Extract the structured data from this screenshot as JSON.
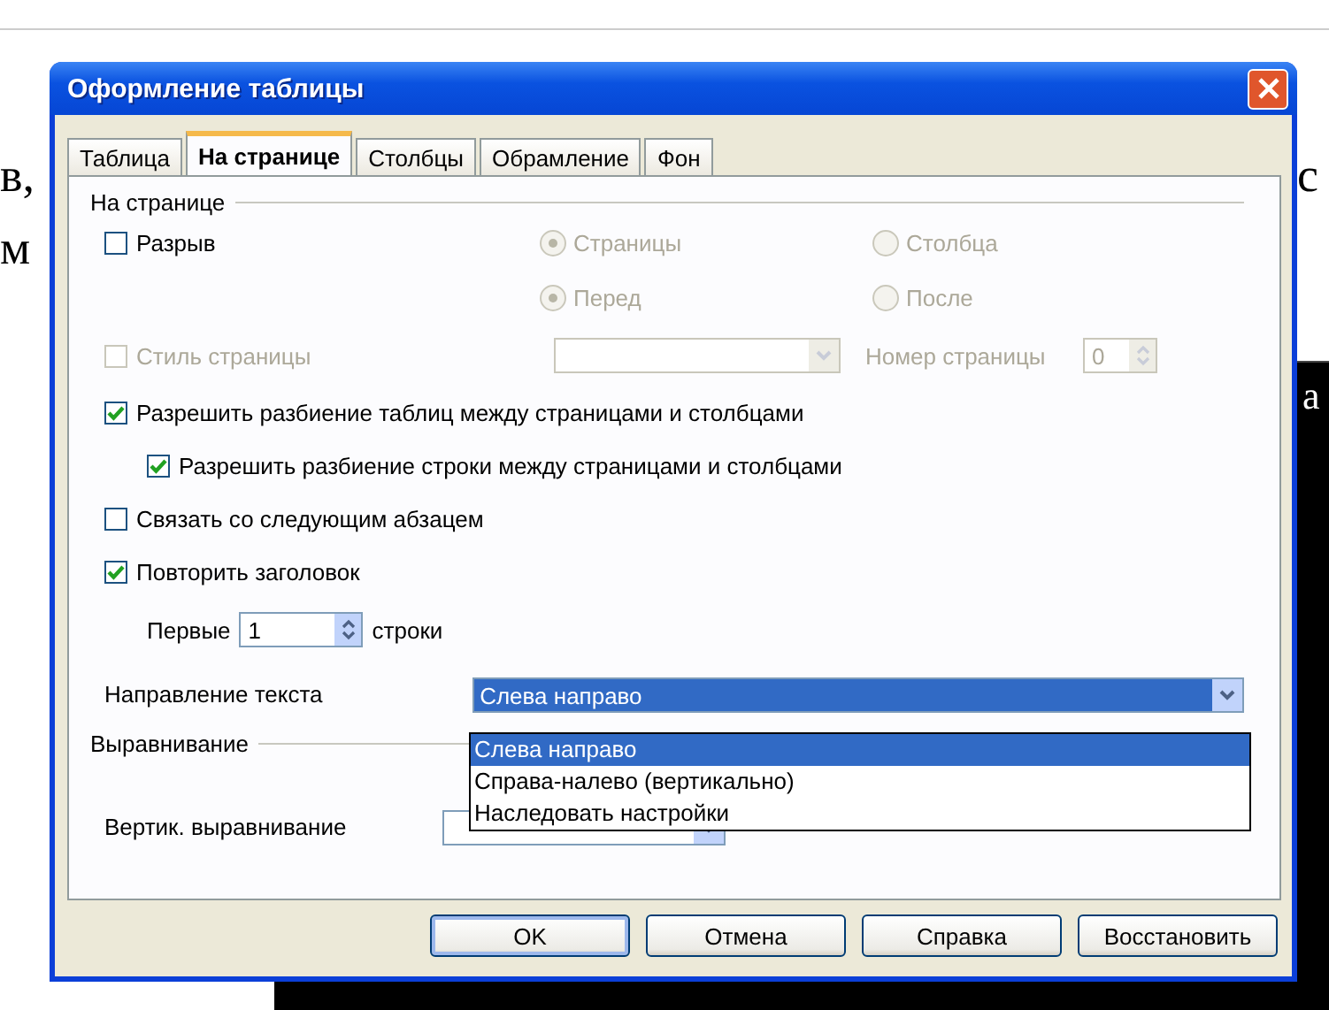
{
  "document": {
    "fragments": [
      {
        "text": "в,",
        "kind": "plain"
      },
      {
        "text": "с",
        "kind": "plain"
      },
      {
        "text": "м",
        "kind": "plain"
      },
      {
        "text": "a",
        "kind": "inverse"
      }
    ]
  },
  "dialog": {
    "title": "Оформление таблицы",
    "tabs": [
      {
        "label": "Таблица",
        "selected": false
      },
      {
        "label": "На странице",
        "selected": true
      },
      {
        "label": "Столбцы",
        "selected": false
      },
      {
        "label": "Обрамление",
        "selected": false
      },
      {
        "label": "Фон",
        "selected": false
      }
    ],
    "section_page": "На странице",
    "break": {
      "label": "Разрыв",
      "checked": false
    },
    "radios": [
      {
        "label": "Страницы",
        "selected": true,
        "disabled": true
      },
      {
        "label": "Столбца",
        "selected": false,
        "disabled": true
      },
      {
        "label": "Перед",
        "selected": true,
        "disabled": true
      },
      {
        "label": "После",
        "selected": false,
        "disabled": true
      }
    ],
    "page_style": {
      "label": "Стиль страницы",
      "checked": false,
      "disabled": true
    },
    "page_number": {
      "label": "Номер страницы",
      "value": "0",
      "disabled": true
    },
    "split_table": {
      "label": "Разрешить разбиение таблиц между страницами и столбцами",
      "checked": true
    },
    "split_row": {
      "label": "Разрешить разбиение строки между страницами и столбцами",
      "checked": true
    },
    "keep_next": {
      "label": "Связать со следующим абзацем",
      "checked": false
    },
    "repeat_heading": {
      "label": "Повторить заголовок",
      "checked": true
    },
    "first_rows": {
      "label": "Первые",
      "value": "1",
      "suffix": "строки"
    },
    "text_direction": {
      "label": "Направление текста",
      "value": "Слева направо",
      "expanded": true,
      "options": [
        {
          "label": "Слева направо",
          "selected": true
        },
        {
          "label": "Справа-налево (вертикально)",
          "selected": false
        },
        {
          "label": "Наследовать настройки",
          "selected": false
        }
      ]
    },
    "section_align": "Выравнивание",
    "vert_align": {
      "label": "Вертик. выравнивание"
    },
    "buttons": [
      {
        "label": "OK",
        "kind": "default"
      },
      {
        "label": "Отмена",
        "kind": "normal"
      },
      {
        "label": "Справка",
        "kind": "normal"
      },
      {
        "label": "Восстановить",
        "kind": "normal"
      }
    ]
  }
}
